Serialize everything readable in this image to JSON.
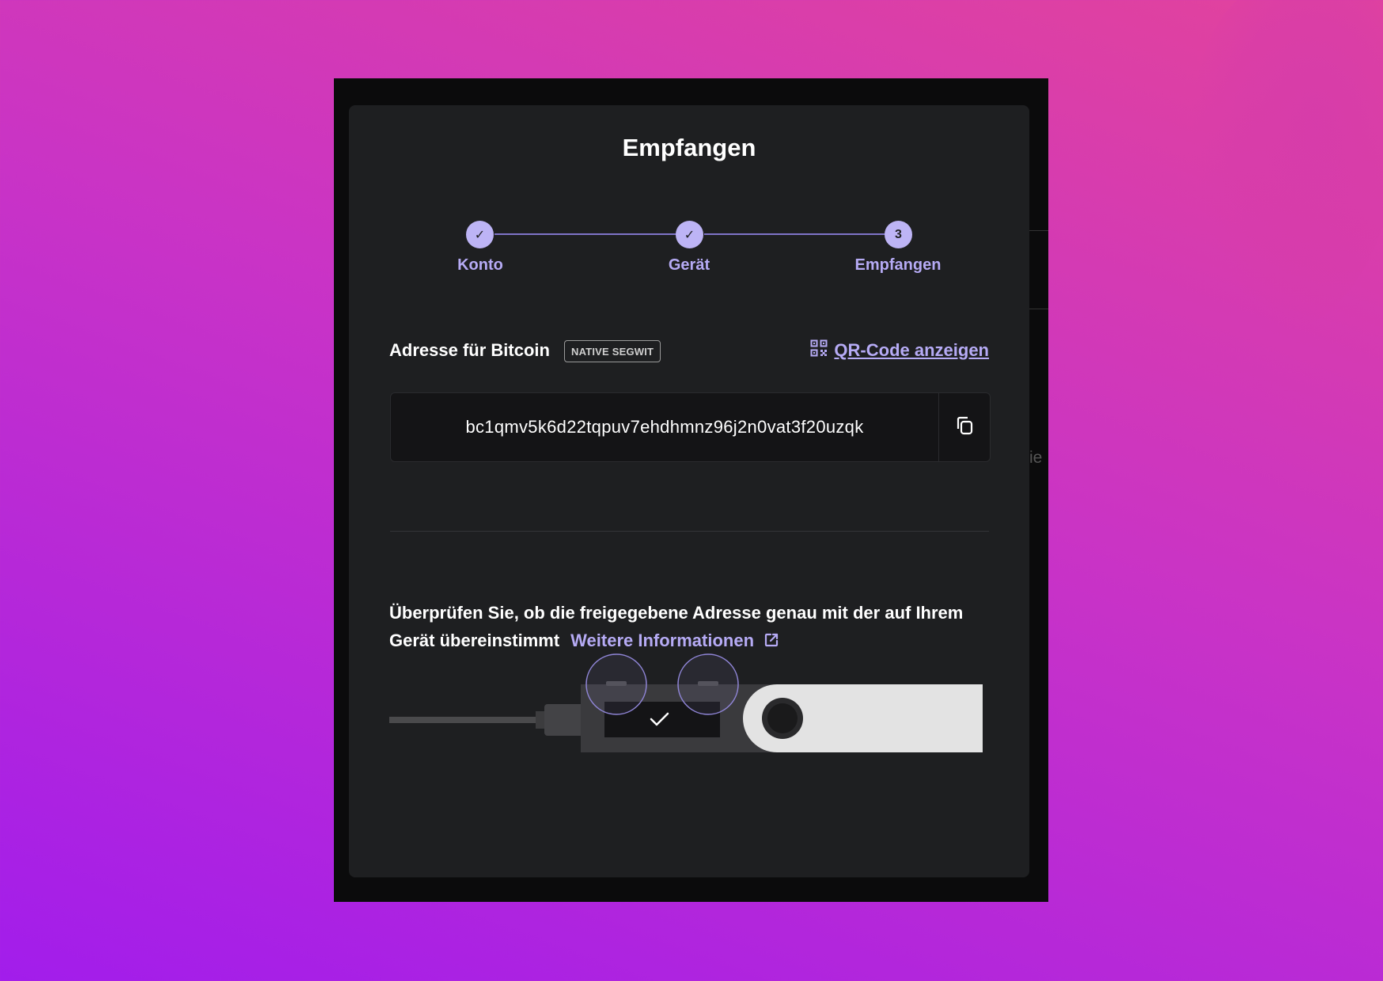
{
  "dialog": {
    "title": "Empfangen"
  },
  "stepper": {
    "steps": [
      {
        "label": "Konto",
        "status": "done",
        "marker": "✓"
      },
      {
        "label": "Gerät",
        "status": "done",
        "marker": "✓"
      },
      {
        "label": "Empfangen",
        "status": "active",
        "marker": "3"
      }
    ]
  },
  "address_section": {
    "label": "Adresse für Bitcoin",
    "badge": "NATIVE SEGWIT",
    "qr_link": "QR-Code anzeigen",
    "address": "bc1qmv5k6d22tqpuv7ehdhmnz96j2n0vat3f20uzqk"
  },
  "verify": {
    "text": "Überprüfen Sie, ob die freigegebene Adresse genau mit der auf Ihrem Gerät übereinstimmt",
    "link": "Weitere Informationen"
  },
  "background_partial": {
    "text": "ie"
  },
  "colors": {
    "accent": "#b6abf5",
    "modal_bg": "#1e1f21",
    "address_bg": "#141416"
  }
}
